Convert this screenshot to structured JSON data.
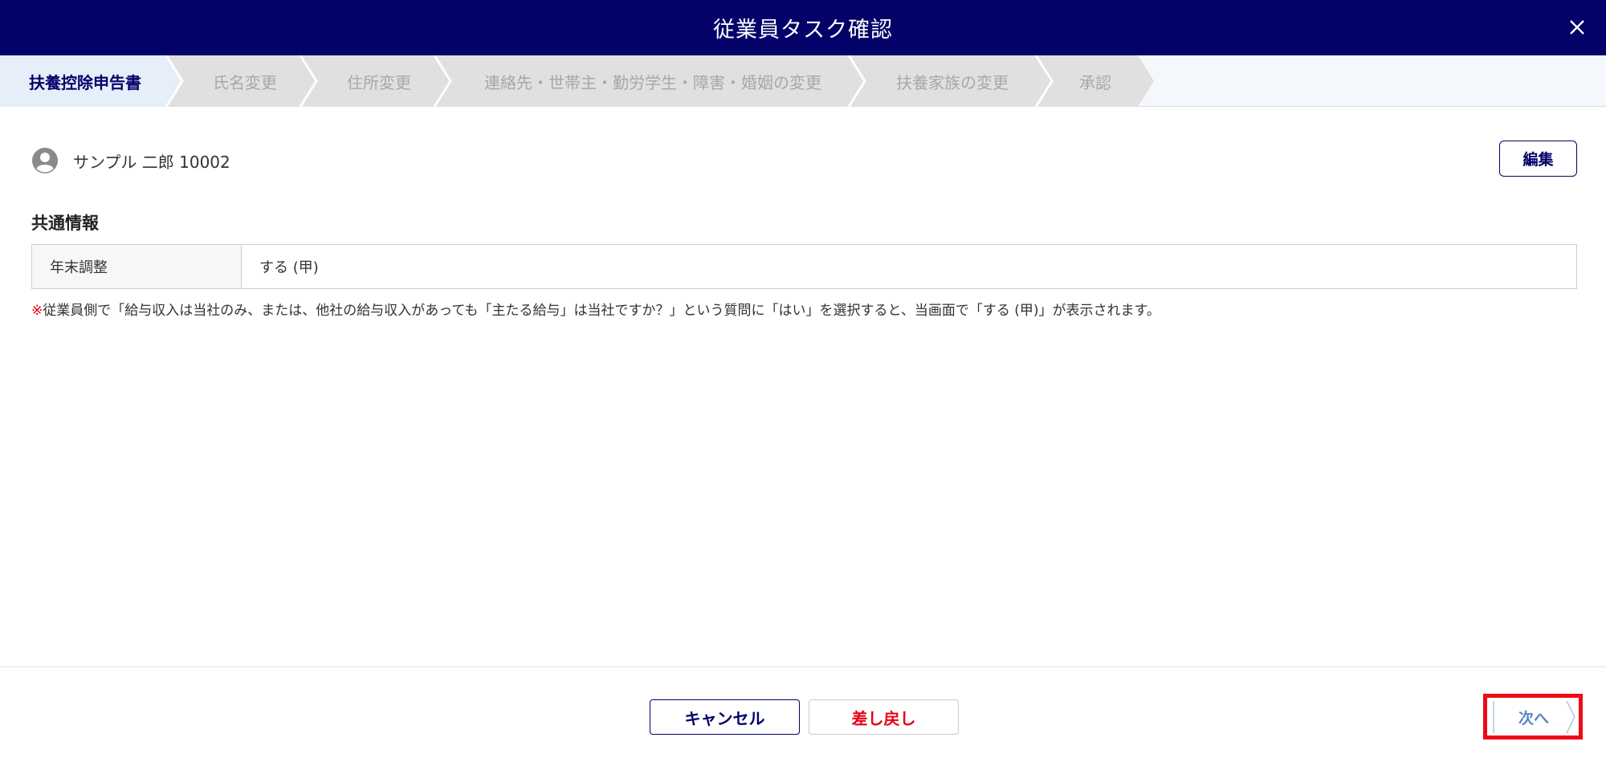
{
  "header": {
    "title": "従業員タスク確認",
    "close_icon": "close-icon"
  },
  "stepper": {
    "steps": [
      {
        "label": "扶養控除申告書",
        "active": true
      },
      {
        "label": "氏名変更",
        "active": false
      },
      {
        "label": "住所変更",
        "active": false
      },
      {
        "label": "連絡先・世帯主・勤労学生・障害・婚姻の変更",
        "active": false
      },
      {
        "label": "扶養家族の変更",
        "active": false
      },
      {
        "label": "承認",
        "active": false
      }
    ]
  },
  "employee": {
    "icon": "user-avatar-icon",
    "name": "サンプル 二郎 10002"
  },
  "edit_button": {
    "label": "編集"
  },
  "common_info": {
    "title": "共通情報",
    "rows": [
      {
        "label": "年末調整",
        "value": "する (甲)"
      }
    ],
    "note_mark": "※",
    "note": "従業員側で「給与収入は当社のみ、または、他社の給与収入があっても「主たる給与」は当社ですか？」という質問に「はい」を選択すると、当画面で「する (甲)」が表示されます。"
  },
  "footer": {
    "cancel_label": "キャンセル",
    "return_label": "差し戻し",
    "next_label": "次へ"
  },
  "colors": {
    "header_bg": "#020269",
    "accent": "#020269",
    "danger": "#e60012",
    "highlight": "#ee0a16",
    "next_text": "#5a86c9"
  }
}
